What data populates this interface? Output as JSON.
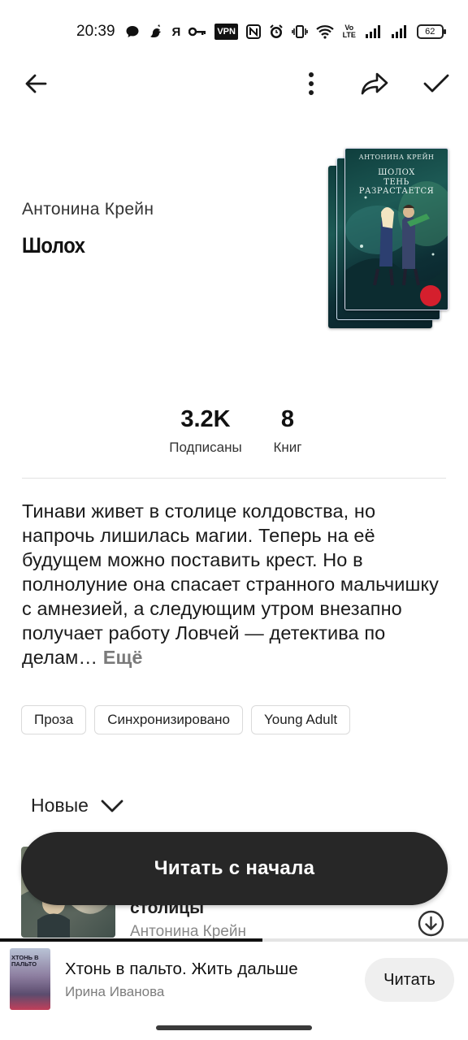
{
  "status_bar": {
    "time": "20:39",
    "icons": [
      "chat-icon",
      "dragon-icon",
      "ya-icon",
      "key-icon",
      "vpn-icon",
      "nfc-icon",
      "alarm-icon",
      "vibrate-icon",
      "wifi-icon",
      "volte-icon",
      "signal-icon",
      "signal-icon"
    ],
    "ya_label": "Я",
    "vpn_label": "VPN",
    "nfc_label": "N",
    "volte_label": "Vo LTE",
    "battery": "62"
  },
  "toolbar": {
    "icons": [
      "back-arrow-icon",
      "more-vertical-icon",
      "share-icon",
      "checkmark-icon"
    ]
  },
  "header": {
    "author": "Антонина Крейн",
    "title": "Шолох"
  },
  "cover": {
    "author_line": "АНТОНИНА КРЕЙН",
    "title_line1": "ШОЛОХ",
    "title_line2": "ТЕНЬ РАЗРАСТАЕТСЯ",
    "colors": {
      "dark": "#0f3e3d",
      "mid": "#1d5a55",
      "accent": "#d51f2d"
    }
  },
  "stats": [
    {
      "value": "3.2K",
      "label": "Подписаны"
    },
    {
      "value": "8",
      "label": "Книг"
    }
  ],
  "description": {
    "text": "Тинави живет в столице колдовства, но напрочь лишилась магии. Теперь на её будущем можно поставить крест. Но в полнолуние она спасает странного мальчишку с амнезией, а следующим утром внезапно получает работу Ловчей — детектива по делам…",
    "more": "Ещё"
  },
  "tags": [
    "Проза",
    "Синхронизировано",
    "Young Adult"
  ],
  "sort": {
    "label": "Новые"
  },
  "list_item": {
    "title": "столицы",
    "author": "Антонина Крейн"
  },
  "primary_button": {
    "label": "Читать с начала",
    "color": "#272727"
  },
  "mini_player": {
    "title": "Хтонь в пальто. Жить дальше",
    "author": "Ирина Иванова",
    "cover_text": "ХТОНЬ В ПАЛЬТО",
    "read_label": "Читать",
    "progress": 0.56
  }
}
